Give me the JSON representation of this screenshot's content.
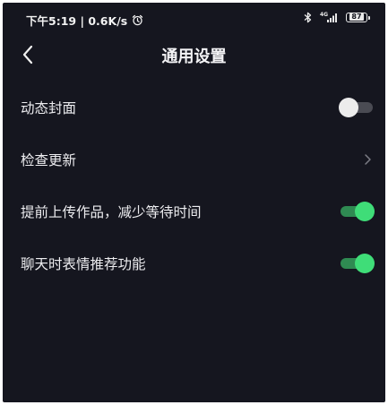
{
  "status_bar": {
    "time_and_speed": "下午5:19 | 0.6K/s",
    "network_label": "4G",
    "battery_level": "87"
  },
  "header": {
    "title": "通用设置"
  },
  "settings": [
    {
      "label": "动态封面",
      "control": "toggle",
      "state": "off"
    },
    {
      "label": "检查更新",
      "control": "chevron"
    },
    {
      "label": "提前上传作品，减少等待时间",
      "control": "toggle",
      "state": "on"
    },
    {
      "label": "聊天时表情推荐功能",
      "control": "toggle",
      "state": "on"
    }
  ],
  "colors": {
    "background": "#15161f",
    "toggle_on": "#3fdd78",
    "toggle_off_knob": "#ececec"
  }
}
